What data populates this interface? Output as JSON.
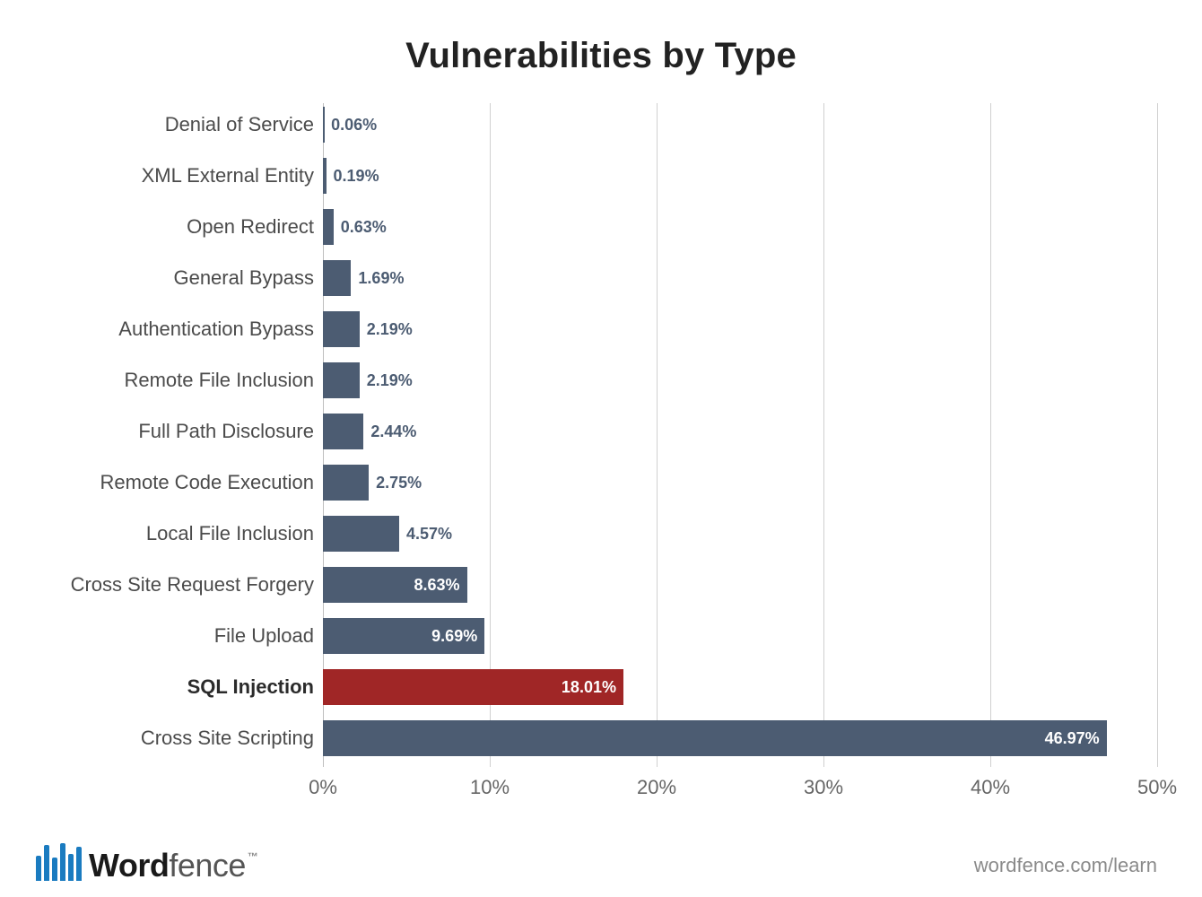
{
  "chart_data": {
    "type": "bar",
    "orientation": "horizontal",
    "title": "Vulnerabilities by Type",
    "xlabel": "",
    "ylabel": "",
    "xlim": [
      0,
      50
    ],
    "x_ticks": [
      0,
      10,
      20,
      30,
      40,
      50
    ],
    "x_tick_labels": [
      "0%",
      "10%",
      "20%",
      "30%",
      "40%",
      "50%"
    ],
    "categories": [
      "Denial of Service",
      "XML External Entity",
      "Open Redirect",
      "General Bypass",
      "Authentication Bypass",
      "Remote File Inclusion",
      "Full Path Disclosure",
      "Remote Code Execution",
      "Local File Inclusion",
      "Cross Site Request Forgery",
      "File Upload",
      "SQL Injection",
      "Cross Site Scripting"
    ],
    "values": [
      0.06,
      0.19,
      0.63,
      1.69,
      2.19,
      2.19,
      2.44,
      2.75,
      4.57,
      8.63,
      9.69,
      18.01,
      46.97
    ],
    "value_labels": [
      "0.06%",
      "0.19%",
      "0.63%",
      "1.69%",
      "2.19%",
      "2.19%",
      "2.44%",
      "2.75%",
      "4.57%",
      "8.63%",
      "9.69%",
      "18.01%",
      "46.97%"
    ],
    "highlight_index": 11,
    "colors": {
      "normal": "#4c5c72",
      "highlight": "#a02626"
    }
  },
  "footer": {
    "brand_word": "Word",
    "brand_fence": "fence",
    "trademark": "™",
    "link_text": "wordfence.com/learn"
  }
}
